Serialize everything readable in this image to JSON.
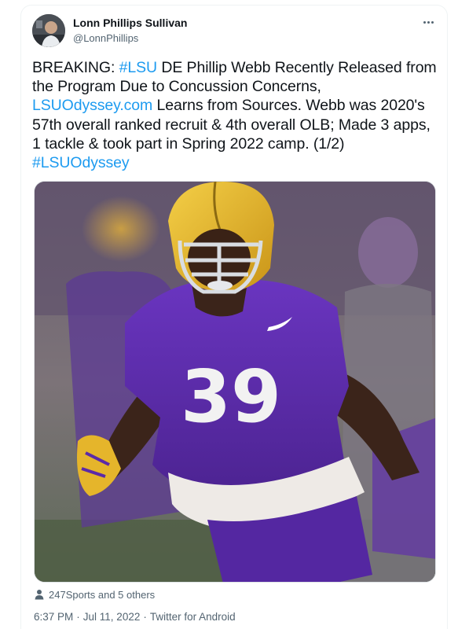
{
  "author": {
    "name": "Lonn Phillips Sullivan",
    "handle": "@LonnPhillips"
  },
  "tweet": {
    "segments": [
      {
        "text": "BREAKING: ",
        "link": false
      },
      {
        "text": "#LSU",
        "link": true
      },
      {
        "text": " DE Phillip Webb Recently Released from the Program Due to Concussion Concerns, ",
        "link": false
      },
      {
        "text": "LSUOdyssey.com",
        "link": true
      },
      {
        "text": " Learns from Sources. Webb was 2020's 57th overall ranked recruit & 4th overall OLB; Made 3 apps, 1 tackle & took part in Spring 2022 camp. (1/2) ",
        "link": false
      },
      {
        "text": "#LSUOdyssey",
        "link": true
      }
    ]
  },
  "media": {
    "jersey_number": "39"
  },
  "tagged": {
    "text": "247Sports and 5 others",
    "icon": "person-icon"
  },
  "meta": {
    "time": "6:37 PM",
    "date": "Jul 11, 2022",
    "source": "Twitter for Android",
    "separator": "·"
  },
  "colors": {
    "link": "#1d9bf0",
    "text": "#0f1419",
    "secondary": "#536471",
    "jersey_purple": "#5b2aa8",
    "helmet_gold": "#e8b92c"
  }
}
